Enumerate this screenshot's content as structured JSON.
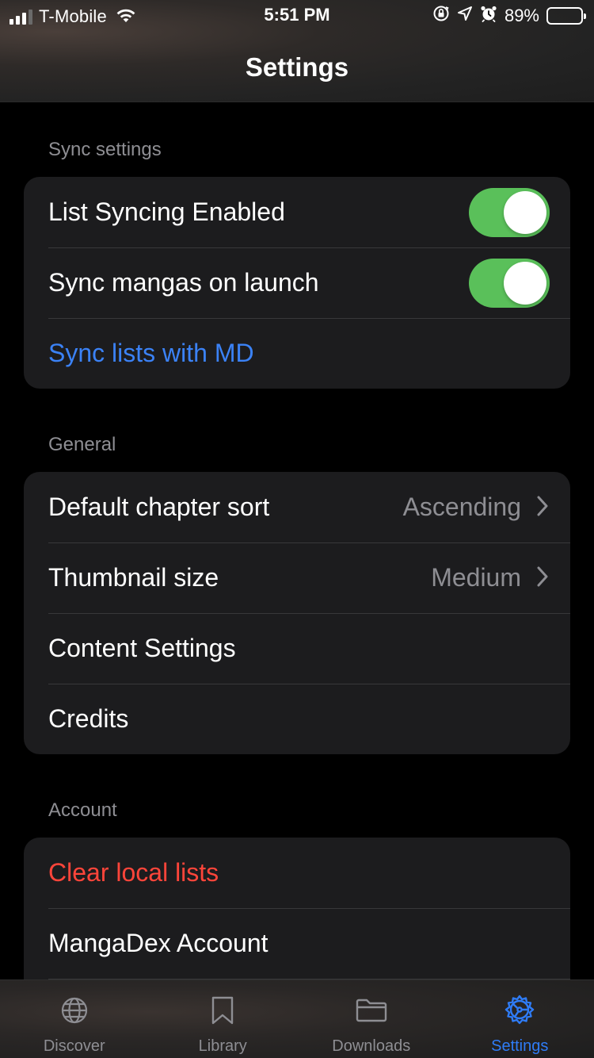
{
  "status_bar": {
    "carrier": "T-Mobile",
    "time": "5:51 PM",
    "battery_percent": "89%",
    "battery_level": 0.89,
    "signal_bars": 3
  },
  "nav": {
    "title": "Settings"
  },
  "sections": {
    "sync": {
      "header": "Sync settings",
      "list_syncing_label": "List Syncing Enabled",
      "list_syncing_on": true,
      "sync_on_launch_label": "Sync mangas on launch",
      "sync_on_launch_on": true,
      "sync_lists_label": "Sync lists with MD"
    },
    "general": {
      "header": "General",
      "chapter_sort_label": "Default chapter sort",
      "chapter_sort_value": "Ascending",
      "thumbnail_label": "Thumbnail size",
      "thumbnail_value": "Medium",
      "content_settings_label": "Content Settings",
      "credits_label": "Credits"
    },
    "account": {
      "header": "Account",
      "clear_lists_label": "Clear local lists",
      "mangadex_account_label": "MangaDex Account"
    }
  },
  "tabs": [
    {
      "label": "Discover",
      "icon": "globe-icon",
      "active": false
    },
    {
      "label": "Library",
      "icon": "bookmark-icon",
      "active": false
    },
    {
      "label": "Downloads",
      "icon": "folder-icon",
      "active": false
    },
    {
      "label": "Settings",
      "icon": "settings-gear-icon",
      "active": true
    }
  ],
  "colors": {
    "accent_blue": "#2f7cf6",
    "destructive_red": "#ff453a",
    "toggle_green": "#5ac05a",
    "group_bg": "#1c1c1e"
  }
}
